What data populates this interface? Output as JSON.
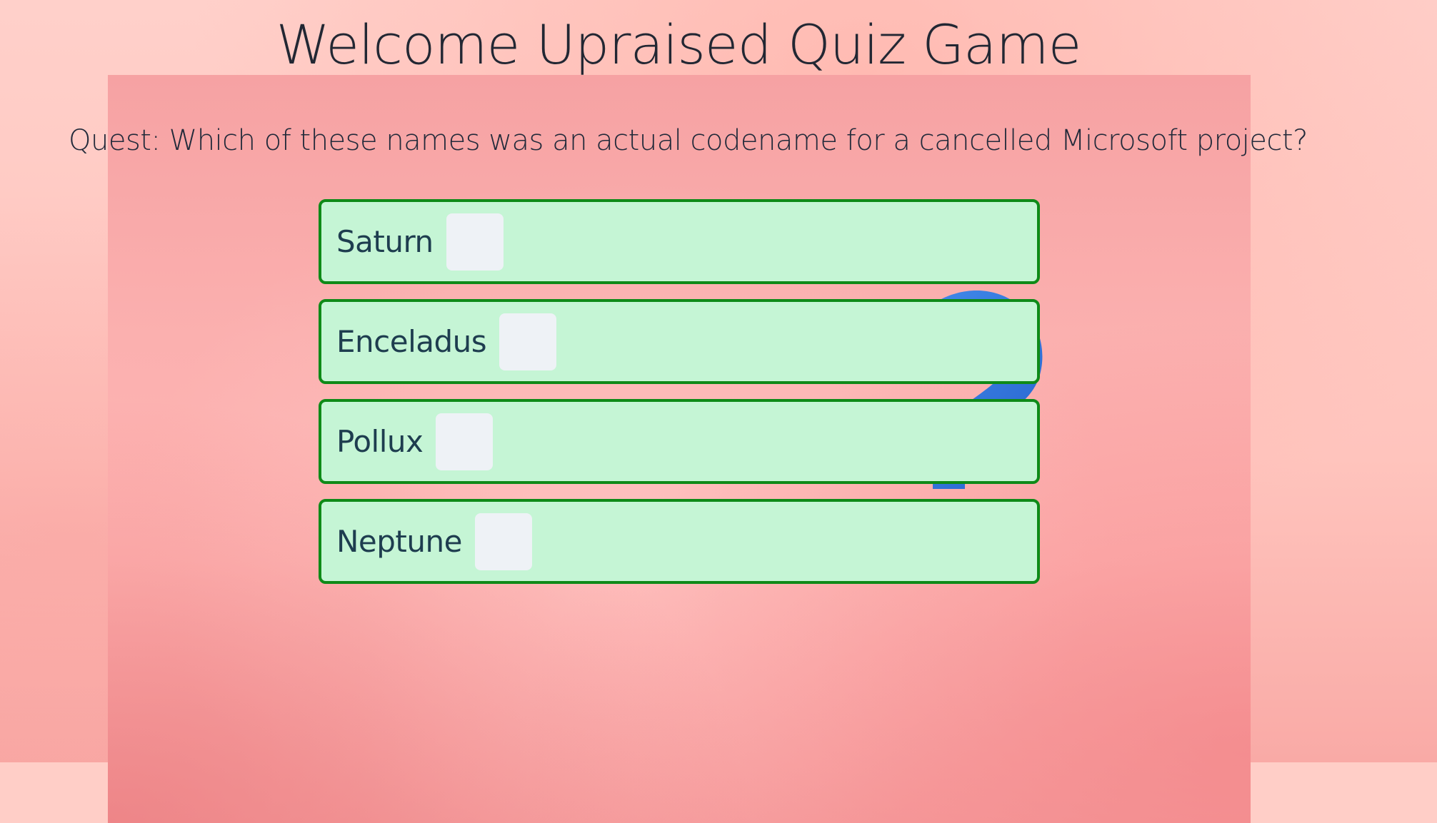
{
  "page": {
    "title": "Welcome Upraised Quiz Game"
  },
  "question": {
    "prefix": "Quest:",
    "text": "Which of these names was an actual codename for a cancelled Microsoft project?",
    "full": "Quest:  Which of these names was an actual codename for a cancelled Microsoft project?"
  },
  "answers": [
    {
      "label": "Saturn"
    },
    {
      "label": "Enceladus"
    },
    {
      "label": "Pollux"
    },
    {
      "label": "Neptune"
    }
  ],
  "colors": {
    "answer_background": "#c5f5d5",
    "answer_border": "#0e8a18",
    "answer_text": "#1e3d4f",
    "page_background": "#ffc8c0",
    "decoration_icon": "#2a78e0"
  },
  "icons": {
    "background_decoration": "question-mark-icon"
  }
}
